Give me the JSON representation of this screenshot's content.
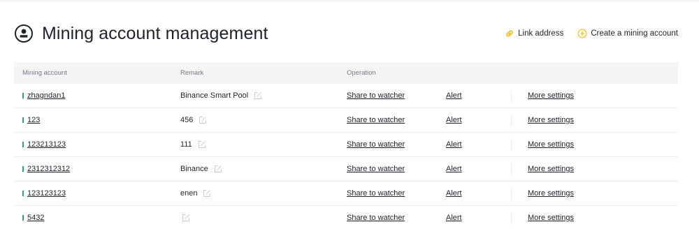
{
  "page": {
    "title": "Mining account management",
    "link_address_label": "Link address",
    "create_account_label": "Create a mining account"
  },
  "colors": {
    "accent": "#f0b90b",
    "marker": "#35a07a",
    "text": "#1e2329",
    "muted": "#707a8a",
    "header_bg": "#f5f5f5"
  },
  "table": {
    "headers": {
      "account": "Mining account",
      "remark": "Remark",
      "operation": "Operation"
    },
    "operation_labels": {
      "share": "Share to watcher",
      "alert": "Alert",
      "more": "More settings"
    },
    "rows": [
      {
        "account": "zhagndan1",
        "remark": "Binance Smart Pool"
      },
      {
        "account": "123",
        "remark": "456"
      },
      {
        "account": "123213123",
        "remark": "111"
      },
      {
        "account": "2312312312",
        "remark": "Binance"
      },
      {
        "account": "123123123",
        "remark": "enen"
      },
      {
        "account": "5432",
        "remark": ""
      }
    ]
  }
}
